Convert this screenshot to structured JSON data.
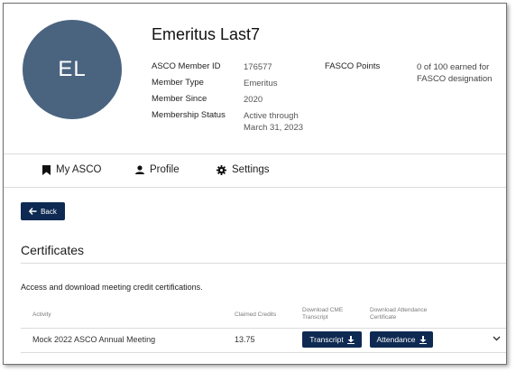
{
  "profile": {
    "initials": "EL",
    "name": "Emeritus Last7",
    "fields": {
      "member_id_label": "ASCO Member ID",
      "member_id_value": "176577",
      "member_type_label": "Member Type",
      "member_type_value": "Emeritus",
      "member_since_label": "Member Since",
      "member_since_value": "2020",
      "status_label": "Membership Status",
      "status_value_line1": "Active through",
      "status_value_line2": "March 31, 2023",
      "fasco_label": "FASCO Points",
      "fasco_value_line1": "0 of 100 earned for",
      "fasco_value_line2": "FASCO designation"
    },
    "avatar_color": "#4a6480"
  },
  "nav": {
    "my_asco": "My ASCO",
    "profile": "Profile",
    "settings": "Settings"
  },
  "back_label": "Back",
  "certificates": {
    "title": "Certificates",
    "description": "Access and download meeting credit certifications.",
    "columns": {
      "activity": "Activity",
      "claimed": "Claimed Credits",
      "cme_line1": "Download CME",
      "cme_line2": "Transcript",
      "attendance_line1": "Download Attendance",
      "attendance_line2": "Certificate"
    },
    "rows": [
      {
        "activity": "Mock 2022 ASCO Annual Meeting",
        "claimed": "13.75",
        "transcript_label": "Transcript",
        "attendance_label": "Attendance"
      }
    ]
  },
  "colors": {
    "primary_button": "#0e2a52",
    "divider": "#dcdcdc"
  }
}
